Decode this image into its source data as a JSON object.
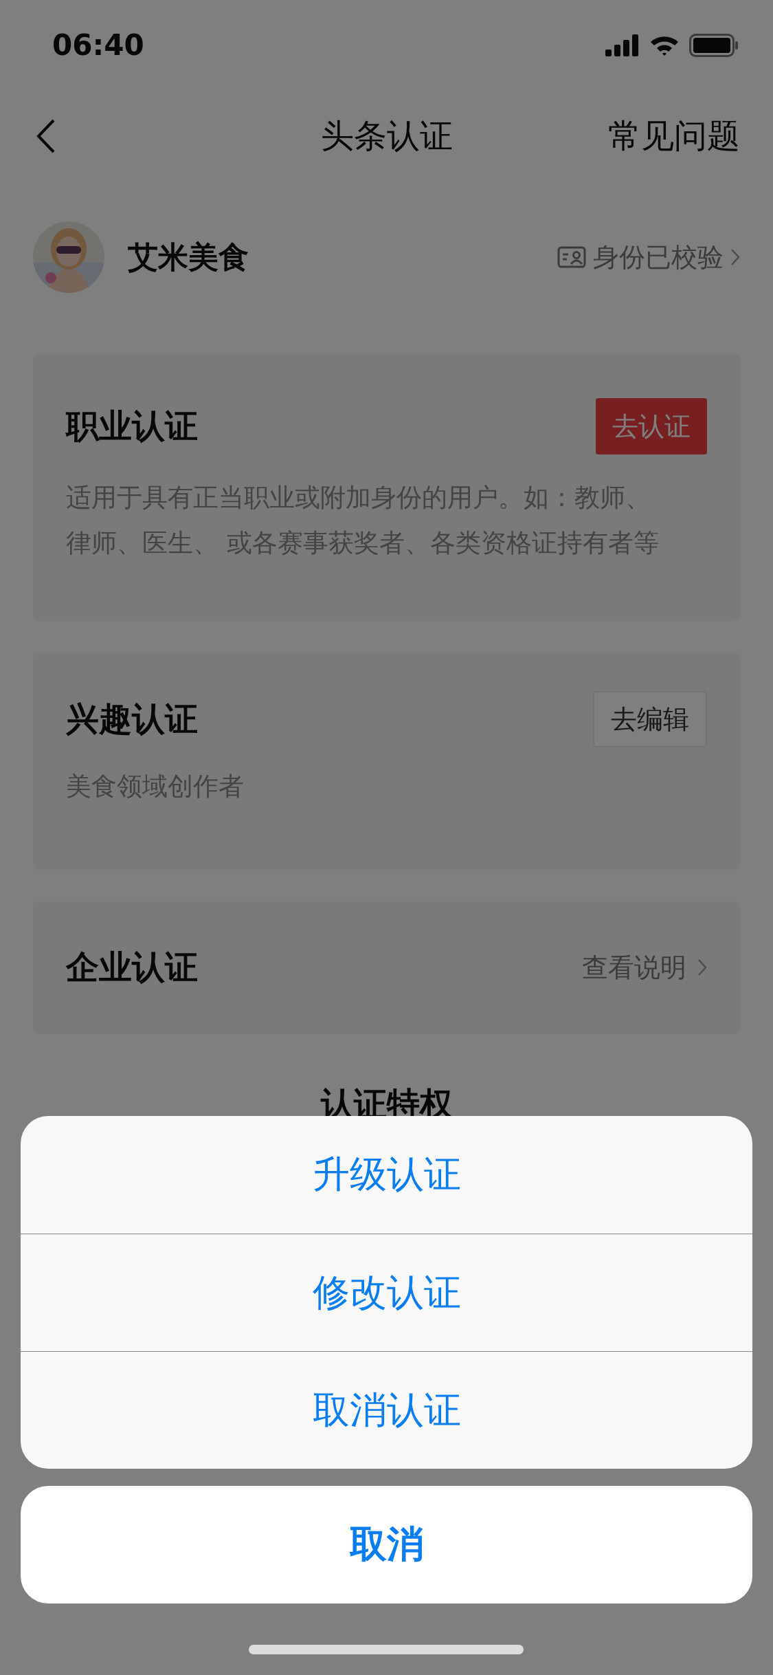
{
  "status_bar": {
    "time": "06:40"
  },
  "nav_bar": {
    "title": "头条认证",
    "right_action": "常见问题"
  },
  "profile": {
    "name": "艾米美食",
    "verification_status": "身份已校验"
  },
  "cards": [
    {
      "title": "职业认证",
      "kind": "primary",
      "action": "去认证",
      "description_lines": [
        "适用于具有正当职业或附加身份的用户。如：教师、",
        "律师、医生、 或各赛事获奖者、各类资格证持有者等"
      ]
    },
    {
      "title": "兴趣认证",
      "kind": "outline",
      "action": "去编辑",
      "description_lines": [
        "美食领域创作者"
      ]
    },
    {
      "title": "企业认证",
      "kind": "link",
      "action": "查看说明"
    }
  ],
  "section_heading": "认证特权",
  "action_sheet": {
    "options": [
      "升级认证",
      "修改认证",
      "取消认证"
    ],
    "cancel": "取消"
  }
}
